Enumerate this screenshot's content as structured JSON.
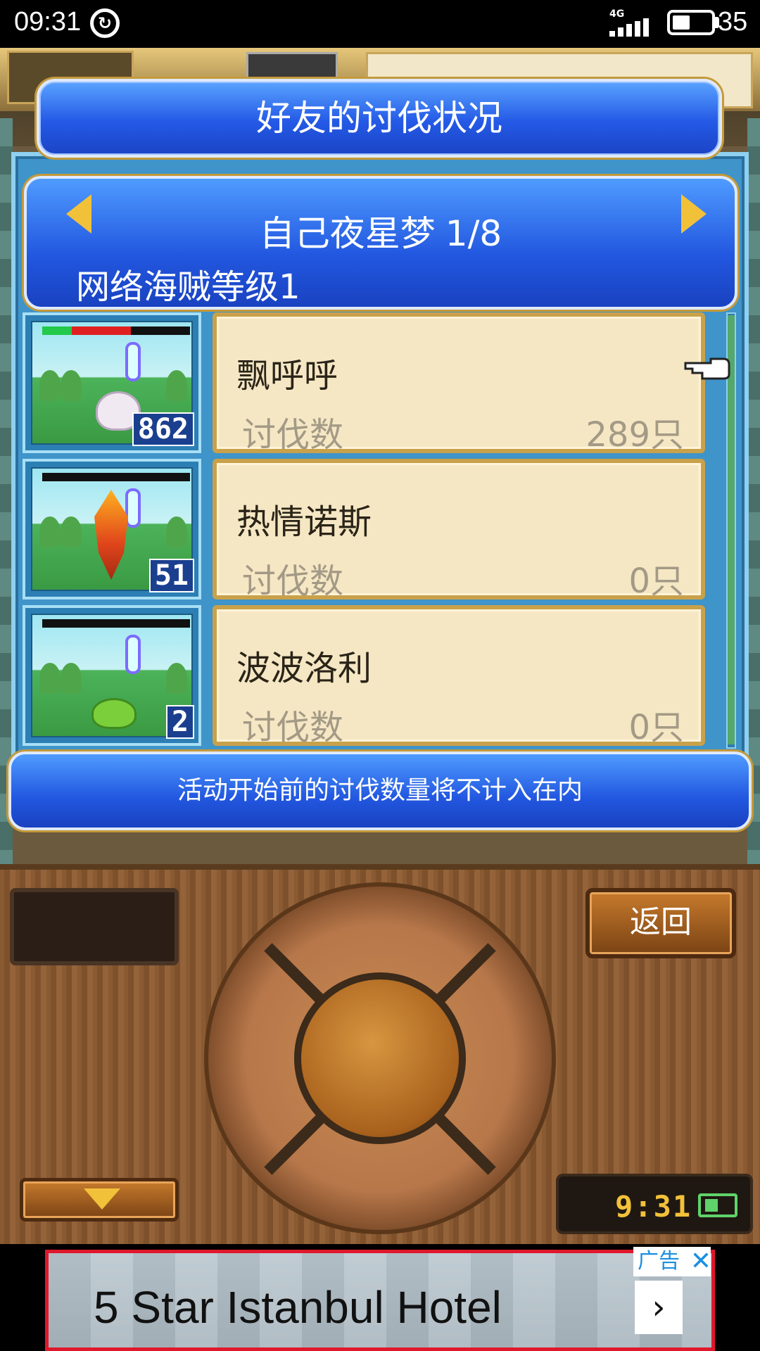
{
  "status_bar": {
    "time": "09:31",
    "network": "4G",
    "battery": "35"
  },
  "dialog": {
    "title": "好友的讨伐状况",
    "friend": {
      "name": "自己夜星梦",
      "page": "1/8",
      "rank": "网络海贼等级1"
    },
    "kills_label": "讨伐数",
    "monsters": [
      {
        "name": "飘呼呼",
        "kills": "289只",
        "count": "862",
        "hp_green": 0.2,
        "hp_red": 0.4
      },
      {
        "name": "热情诺斯",
        "kills": "0只",
        "count": "51",
        "hp_green": 0,
        "hp_red": 0
      },
      {
        "name": "波波洛利",
        "kills": "0只",
        "count": "2",
        "hp_green": 0,
        "hp_red": 0
      }
    ],
    "note": "活动开始前的讨伐数量将不计入在内"
  },
  "controller": {
    "back_label": "返回",
    "clock": "9:31"
  },
  "ad": {
    "text": "5 Star Istanbul Hotel",
    "tag": "广告",
    "close": "✕",
    "chevron": "›"
  },
  "colors": {
    "banner_blue": "#2459e6",
    "card_bg": "#f6e7c4",
    "gold_border": "#c9a14a",
    "ad_border": "#e0182c"
  }
}
